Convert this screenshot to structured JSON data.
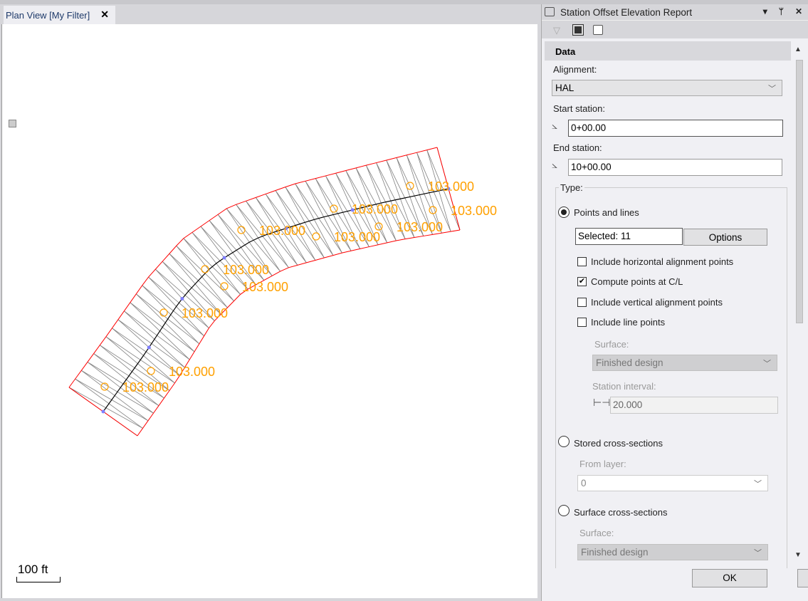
{
  "tab": {
    "label": "Plan View [My Filter]",
    "close": "✕"
  },
  "view": {
    "scale_label": "100 ft",
    "point_labels": [
      "103.000",
      "103.000",
      "103.000",
      "103.000",
      "103.000",
      "103.000",
      "103.000",
      "103.000",
      "103.000",
      "103.000",
      "103.000"
    ],
    "colors": {
      "boundary": "#ff0000",
      "triangles": "#808080",
      "centerline": "#000000",
      "labels": "#ffa000",
      "vertex": "#8080ff"
    }
  },
  "panel": {
    "title": "Station Offset Elevation Report",
    "section": "Data",
    "alignment_label": "Alignment:",
    "alignment_value": "HAL",
    "start_label": "Start station:",
    "start_value": "0+00.00",
    "end_label": "End station:",
    "end_value": "10+00.00",
    "type_label": "Type:",
    "opt_points": "Points and lines",
    "selected": "Selected: 11",
    "options_btn": "Options",
    "cb_hal": "Include horizontal alignment points",
    "cb_hal_checked": false,
    "cb_cl": "Compute points at C/L",
    "cb_cl_checked": true,
    "cb_val": "Include vertical alignment points",
    "cb_val_checked": false,
    "cb_line": "Include line points",
    "cb_line_checked": false,
    "surface_label": "Surface:",
    "surface_value": "Finished design",
    "interval_label": "Station interval:",
    "interval_value": "20.000",
    "opt_stored": "Stored cross-sections",
    "layer_label": "From layer:",
    "layer_value": "0",
    "opt_surface": "Surface cross-sections",
    "surface2_label": "Surface:",
    "surface2_value": "Finished design",
    "ok": "OK",
    "check": "✔"
  }
}
